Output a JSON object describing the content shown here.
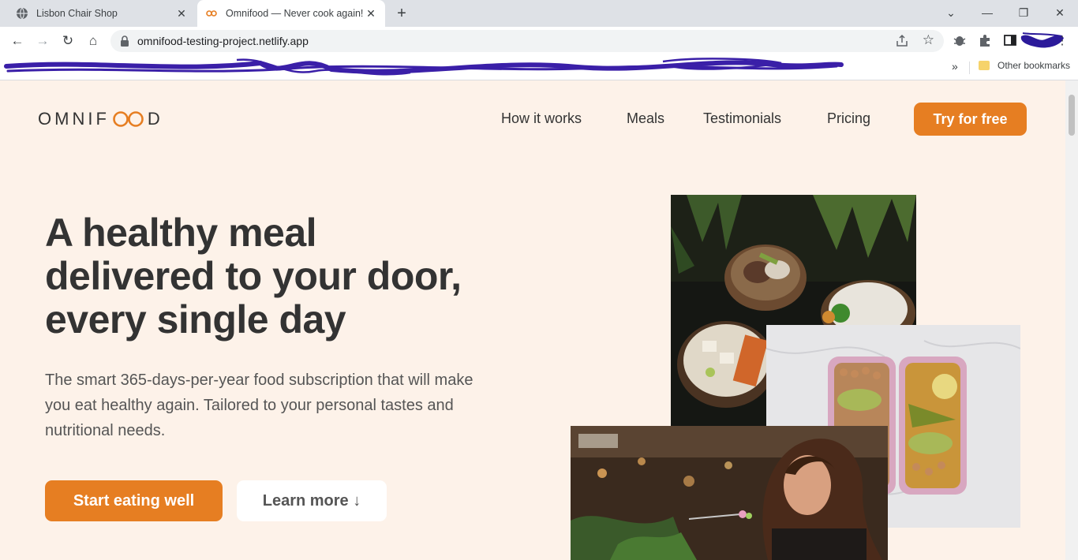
{
  "browser": {
    "tabs": [
      {
        "title": "Lisbon Chair Shop",
        "active": false
      },
      {
        "title": "Omnifood — Never cook again!",
        "active": true
      }
    ],
    "url": "omnifood-testing-project.netlify.app",
    "bookmarks_other": "Other bookmarks"
  },
  "site": {
    "logo_left": "OMNIF",
    "logo_right": "D",
    "nav": {
      "how_it_works": "How it works",
      "meals": "Meals",
      "testimonials": "Testimonials",
      "pricing": "Pricing",
      "cta": "Try for free"
    },
    "hero": {
      "title_line1": "A healthy meal",
      "title_line2": "delivered to your door,",
      "title_line3": "every single day",
      "description": "The smart 365-days-per-year food subscription that will make you eat healthy again. Tailored to your personal tastes and nutritional needs.",
      "primary_button": "Start eating well",
      "secondary_button": "Learn more ↓"
    }
  },
  "colors": {
    "brand": "#e67e22",
    "background": "#fdf2e9",
    "text": "#333333",
    "scribble": "#3a1fa8"
  }
}
